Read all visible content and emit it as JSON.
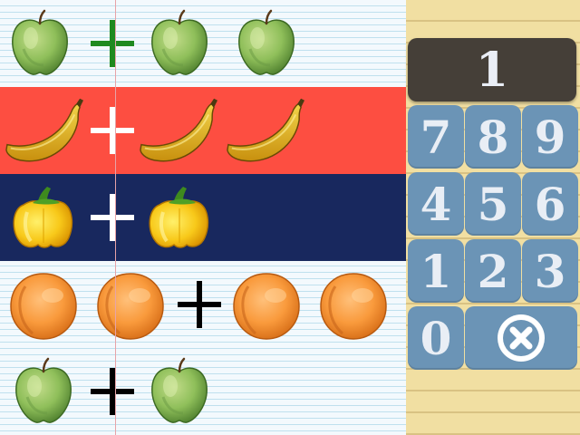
{
  "answer_display": "1",
  "keypad": {
    "keys": [
      "7",
      "8",
      "9",
      "4",
      "5",
      "6",
      "1",
      "2",
      "3",
      "0"
    ],
    "clear_icon": "clear-icon"
  },
  "rows": [
    {
      "background": "notebook",
      "operator_color": "#1f8a1f",
      "items": [
        "apple",
        "apple",
        "apple"
      ],
      "operator_after": 1
    },
    {
      "background": "#fd4e41",
      "operator_color": "#ffffff",
      "items": [
        "banana",
        "banana",
        "banana"
      ],
      "operator_after": 1
    },
    {
      "background": "#18285e",
      "operator_color": "#ffffff",
      "items": [
        "pepper",
        "pepper"
      ],
      "operator_after": 1
    },
    {
      "background": "notebook",
      "operator_color": "#000000",
      "items": [
        "peach",
        "peach",
        "peach",
        "peach"
      ],
      "operator_after": 2
    },
    {
      "background": "notebook",
      "operator_color": "#000000",
      "items": [
        "apple",
        "apple"
      ],
      "operator_after": 1
    }
  ],
  "colors": {
    "display_bg": "#453f38",
    "key_bg": "#6b94b6",
    "pad_bg": "#f1dfa2"
  }
}
